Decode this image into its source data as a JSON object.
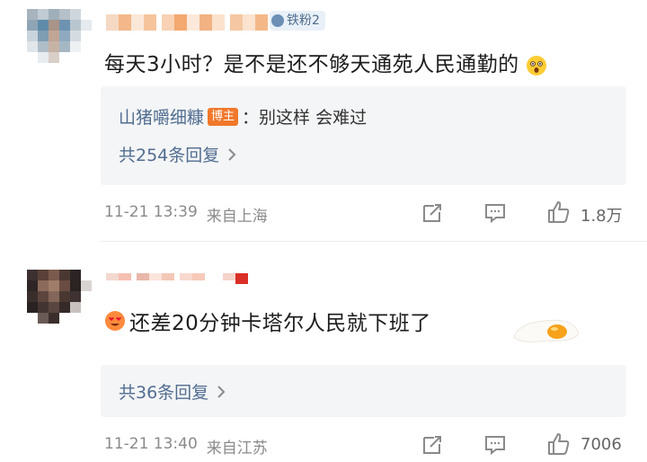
{
  "comments": [
    {
      "user_tag": "铁粉2",
      "text_prefix": "",
      "text": "每天3小时？是不是还不够天通苑人民通勤的",
      "emoji": "astonished-emoji",
      "reply": {
        "author": "山猪嚼细糠",
        "badge": "博主",
        "separator": "：",
        "text": "别这样 会难过"
      },
      "more_replies": "共254条回复",
      "time": "11-21 13:39",
      "location": "来自上海",
      "likes": "1.8万"
    },
    {
      "text": "还差20分钟卡塔尔人民就下班了",
      "emoji": "heart-eyes-emoji",
      "more_replies": "共36条回复",
      "time": "11-21 13:40",
      "location": "来自江苏",
      "likes": "7006"
    }
  ],
  "colors": {
    "link_blue": "#516d91",
    "badge_orange": "#f1782b",
    "meta_gray": "#8a8a8a",
    "reply_bg": "#f4f5f6"
  },
  "icons": [
    "share-icon",
    "comment-icon",
    "like-icon",
    "chevron-right-icon"
  ]
}
